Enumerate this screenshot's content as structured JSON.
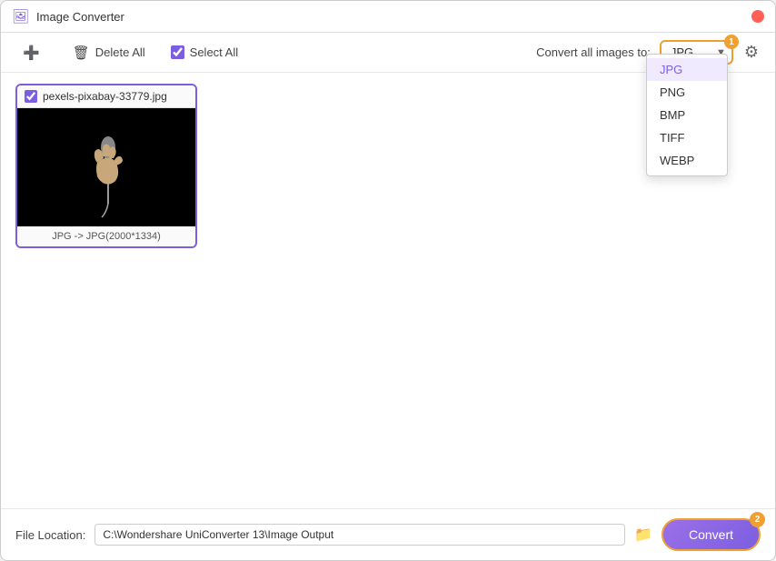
{
  "window": {
    "title": "Image Converter"
  },
  "toolbar": {
    "delete_all_label": "Delete All",
    "select_all_label": "Select All",
    "convert_all_label": "Convert all images to:",
    "selected_format": "JPG"
  },
  "formats": {
    "options": [
      "JPG",
      "PNG",
      "BMP",
      "TIFF",
      "WEBP"
    ],
    "selected": "JPG"
  },
  "image_card": {
    "filename": "pexels-pixabay-33779.jpg",
    "info": "JPG -> JPG(2000*1334)",
    "checked": true
  },
  "footer": {
    "file_location_label": "File Location:",
    "file_path": "C:\\Wondershare UniConverter 13\\Image Output",
    "convert_label": "Convert"
  },
  "badges": {
    "format_badge": "1",
    "convert_badge": "2"
  }
}
